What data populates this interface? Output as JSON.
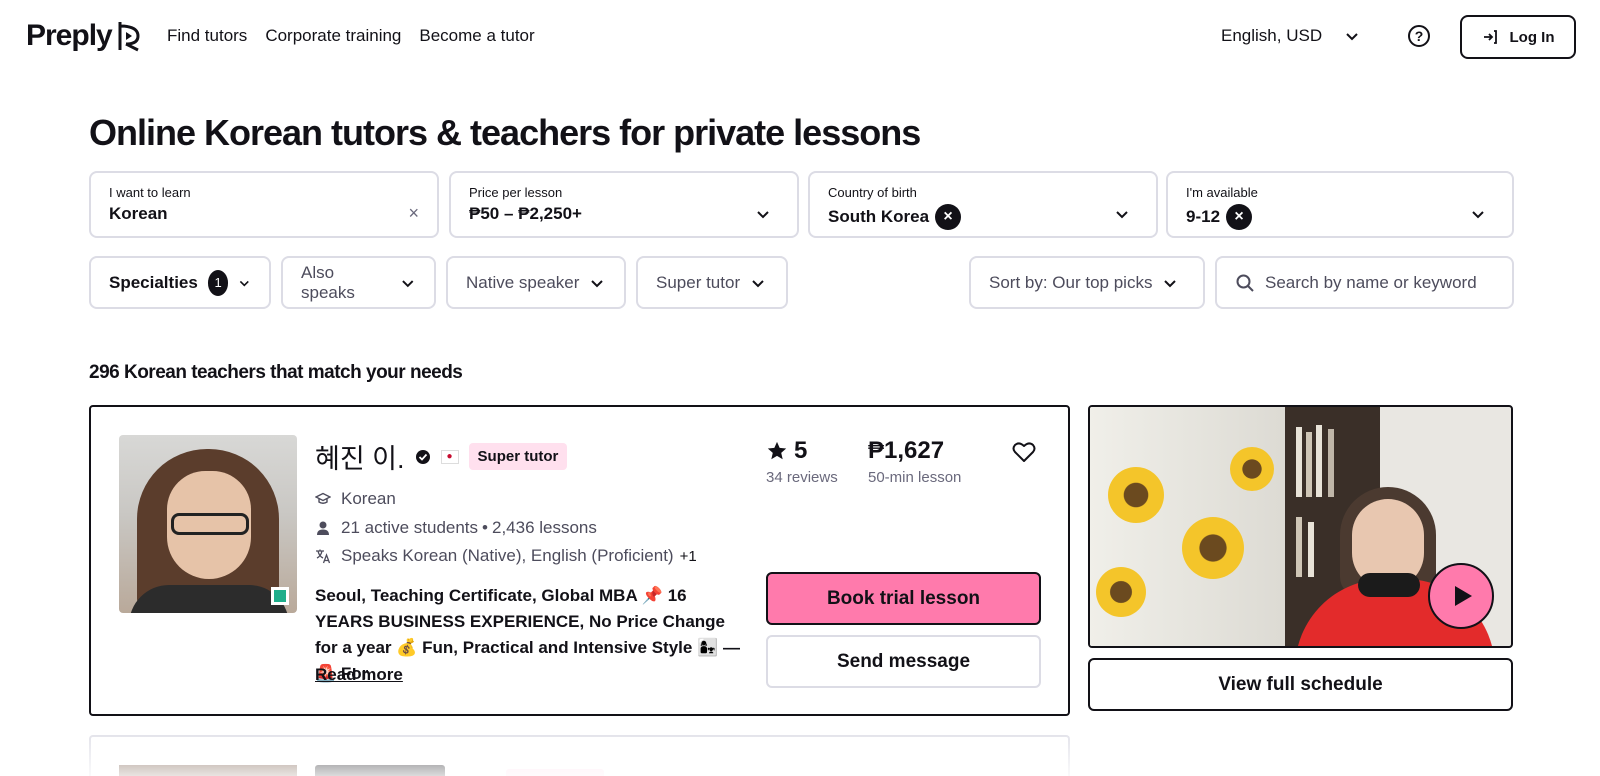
{
  "header": {
    "logo_text": "Preply",
    "nav": [
      "Find tutors",
      "Corporate training",
      "Become a tutor"
    ],
    "language": "English, USD",
    "login_label": "Log In"
  },
  "title": "Online Korean tutors & teachers for private lessons",
  "filters": {
    "learn": {
      "label": "I want to learn",
      "value": "Korean"
    },
    "price": {
      "label": "Price per lesson",
      "value": "₱50 – ₱2,250+"
    },
    "country": {
      "label": "Country of birth",
      "value": "South Korea"
    },
    "available": {
      "label": "I'm available",
      "value": "9-12"
    }
  },
  "pills": {
    "specialties": "Specialties",
    "specialties_count": "1",
    "also_speaks": "Also speaks",
    "native_speaker": "Native speaker",
    "super_tutor": "Super tutor",
    "sort": "Sort by: Our top picks",
    "search_placeholder": "Search by name or keyword"
  },
  "results_count": "296 Korean teachers that match your needs",
  "tutor": {
    "name": "혜진 이.",
    "badge": "Super tutor",
    "subject": "Korean",
    "students": "21 active students",
    "lessons": "2,436 lessons",
    "speaks": "Speaks Korean (Native), English (Proficient)",
    "speaks_more": "+1",
    "description": "Seoul, Teaching Certificate, Global MBA 📌 16 YEARS BUSINESS EXPERIENCE, No Price Change for a year 💰 Fun, Practical and Intensive Style 👩‍👧 — 🚨 For",
    "read_more": "Read more",
    "rating": "5",
    "reviews": "34 reviews",
    "price": "₱1,627",
    "price_note": "50-min lesson",
    "book_label": "Book trial lesson",
    "send_label": "Send message",
    "schedule_label": "View full schedule"
  },
  "colors": {
    "accent_pink": "#ff7aac",
    "super_bg": "#ffe0ee",
    "online": "#1fae8b"
  }
}
